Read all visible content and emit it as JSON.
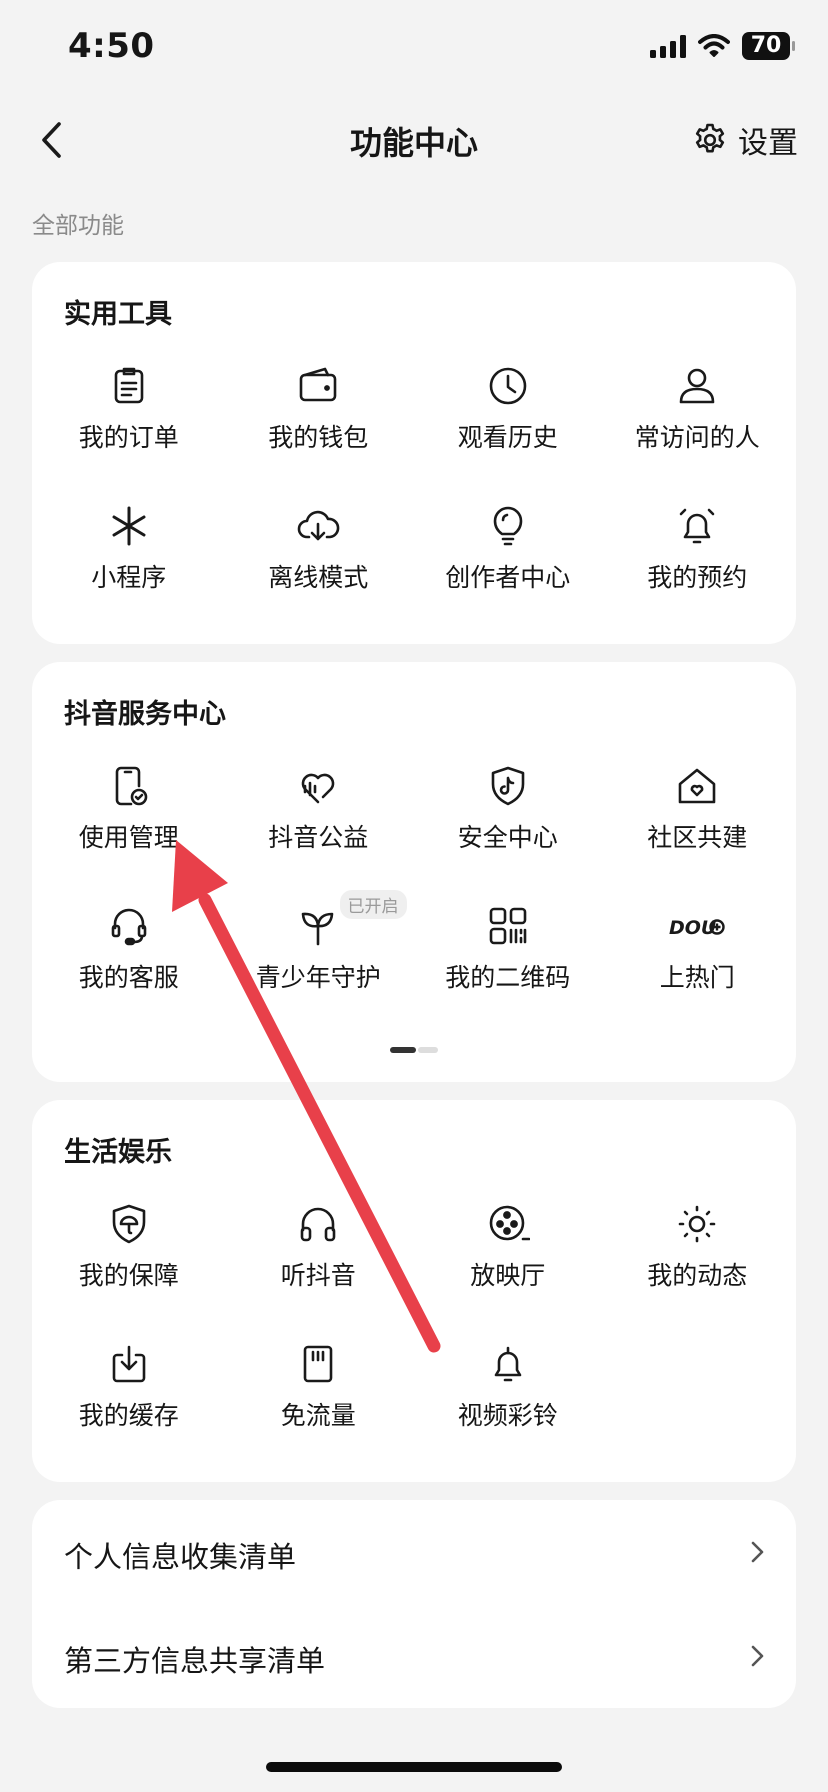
{
  "status_bar": {
    "time": "4:50",
    "battery": "70"
  },
  "nav": {
    "title": "功能中心",
    "settings_label": "设置"
  },
  "section_caption": "全部功能",
  "cards": [
    {
      "title": "实用工具",
      "items": [
        {
          "label": "我的订单",
          "icon": "clipboard-icon"
        },
        {
          "label": "我的钱包",
          "icon": "wallet-icon"
        },
        {
          "label": "观看历史",
          "icon": "clock-icon"
        },
        {
          "label": "常访问的人",
          "icon": "person-icon"
        },
        {
          "label": "小程序",
          "icon": "asterisk-icon"
        },
        {
          "label": "离线模式",
          "icon": "cloud-download-icon"
        },
        {
          "label": "创作者中心",
          "icon": "lightbulb-icon"
        },
        {
          "label": "我的预约",
          "icon": "bell-ring-icon"
        }
      ]
    },
    {
      "title": "抖音服务中心",
      "items": [
        {
          "label": "使用管理",
          "icon": "phone-check-icon"
        },
        {
          "label": "抖音公益",
          "icon": "heart-wave-icon"
        },
        {
          "label": "安全中心",
          "icon": "shield-tiktok-icon"
        },
        {
          "label": "社区共建",
          "icon": "house-heart-icon"
        },
        {
          "label": "我的客服",
          "icon": "headset-icon"
        },
        {
          "label": "青少年守护",
          "icon": "sprout-icon",
          "badge": "已开启"
        },
        {
          "label": "我的二维码",
          "icon": "qr-code-icon"
        },
        {
          "label": "上热门",
          "icon": "dou-plus-icon"
        }
      ]
    },
    {
      "title": "生活娱乐",
      "items": [
        {
          "label": "我的保障",
          "icon": "shield-umbrella-icon"
        },
        {
          "label": "听抖音",
          "icon": "headphones-icon"
        },
        {
          "label": "放映厅",
          "icon": "film-reel-icon"
        },
        {
          "label": "我的动态",
          "icon": "sun-icon"
        },
        {
          "label": "我的缓存",
          "icon": "download-box-icon"
        },
        {
          "label": "免流量",
          "icon": "sim-card-icon"
        },
        {
          "label": "视频彩铃",
          "icon": "bell-icon"
        }
      ]
    }
  ],
  "list": [
    {
      "label": "个人信息收集清单"
    },
    {
      "label": "第三方信息共享清单"
    }
  ],
  "colors": {
    "annotation_arrow": "#e8404a",
    "background": "#f3f3f3"
  }
}
